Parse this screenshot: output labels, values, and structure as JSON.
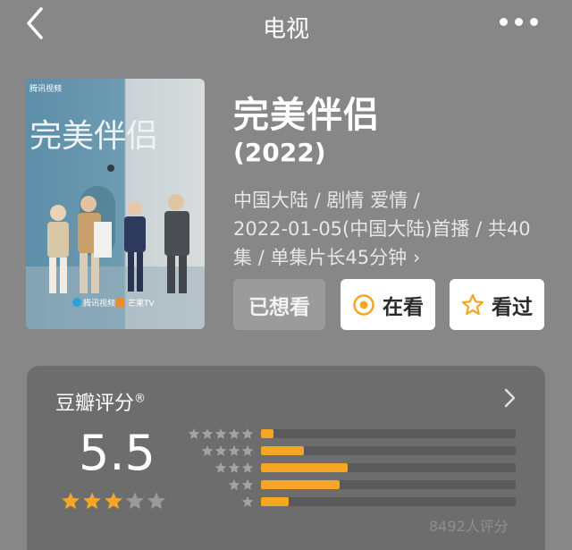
{
  "header": {
    "title": "电视"
  },
  "poster": {
    "title_text": "完美伴侣",
    "badge_tencent": "腾讯视频",
    "badge_mango": "芒果TV"
  },
  "movie": {
    "title": "完美伴侣",
    "year": "(2022)",
    "meta_line1": "中国大陆 / 剧情 爱情 /",
    "meta_line2": "2022-01-05(中国大陆)首播 / 共40",
    "meta_line3": "集 / 单集片长45分钟 ›"
  },
  "actions": {
    "wanted_label": "已想看",
    "watching_label": "在看",
    "watched_label": "看过"
  },
  "rating": {
    "title": "豆瓣评分",
    "registered_mark": "®",
    "score": "5.5",
    "score_value": 5.5,
    "stars_filled": 3,
    "stars_total": 5,
    "count_text": "8492人评分",
    "distribution": [
      {
        "stars": 5,
        "percent": 5
      },
      {
        "stars": 4,
        "percent": 17
      },
      {
        "stars": 3,
        "percent": 34
      },
      {
        "stars": 2,
        "percent": 31
      },
      {
        "stars": 1,
        "percent": 11
      }
    ]
  },
  "colors": {
    "accent_orange": "#f5a623",
    "background": "#878787",
    "card": "#6d6d6d"
  },
  "icons": {
    "back": "chevron-left-icon",
    "more": "more-dots-icon",
    "watching": "target-circle-icon",
    "watched": "star-outline-icon",
    "rating_chevron": "chevron-right-icon"
  }
}
